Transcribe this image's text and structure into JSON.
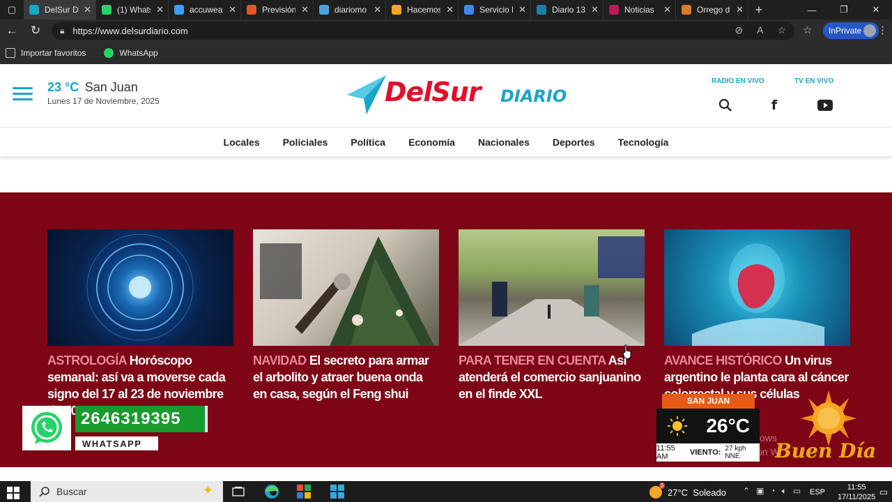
{
  "browser": {
    "tabs": [
      {
        "title": "DelSur Di",
        "color": "#1aa4c8",
        "active": true
      },
      {
        "title": "(1) Whats",
        "color": "#25d366"
      },
      {
        "title": "accuweat",
        "color": "#3aa0ff"
      },
      {
        "title": "Previsión",
        "color": "#e8542a"
      },
      {
        "title": "diariomo",
        "color": "#4aa3df"
      },
      {
        "title": "Hacemos",
        "color": "#f5a623"
      },
      {
        "title": "Servicio M",
        "color": "#4285f4"
      },
      {
        "title": "Diario 13",
        "color": "#1d7fa8"
      },
      {
        "title": "Noticias",
        "color": "#c2185b"
      },
      {
        "title": "Orrego d",
        "color": "#e07a2d"
      }
    ],
    "url": "https://www.delsurdiario.com",
    "inprivate_label": "InPrivate",
    "favorites": [
      {
        "label": "Importar favoritos",
        "icon": "import-favorites-icon"
      },
      {
        "label": "WhatsApp",
        "icon": "whatsapp-icon"
      }
    ]
  },
  "site": {
    "weather": {
      "temp": "23 °C",
      "city": "San Juan",
      "date": "Lunes 17 de Noviembre, 2025"
    },
    "logo": {
      "main": "DelSur",
      "sub": "DIARIO"
    },
    "top_links": {
      "radio": "RADIO EN VIVO",
      "tv": "TV EN VIVO"
    },
    "nav": [
      "Locales",
      "Policiales",
      "Política",
      "Economía",
      "Nacionales",
      "Deportes",
      "Tecnología"
    ],
    "articles": [
      {
        "category": "ASTROLOGÍA",
        "title": "Horóscopo semanal: así va a moverse cada signo del 17 al 23 de noviembre de 2025"
      },
      {
        "category": "NAVIDAD",
        "title": "El secreto para armar el arbolito y atraer buena onda en casa, según el Feng shui"
      },
      {
        "category": "PARA TENER EN CUENTA",
        "title": "Así atenderá el comercio sanjuanino en el finde XXL"
      },
      {
        "category": "AVANCE HISTÓRICO",
        "title": "Un virus argentino le planta cara al cáncer colorrectal y sus células"
      }
    ]
  },
  "overlays": {
    "whatsapp": {
      "number": "2646319395",
      "label": "WHATSAPP"
    },
    "weather_widget": {
      "city": "SAN JUAN",
      "temp": "26°C",
      "time": "11:55 AM",
      "wind_label": "VIENTO:",
      "wind_value": "27 kph NNE"
    },
    "watermark_text": [
      "ows",
      "on Wi"
    ],
    "buen_dia": "Buen Día"
  },
  "taskbar": {
    "search_placeholder": "Buscar",
    "weather": "27°C  Soleado",
    "weather_badge": "3",
    "lang": "ESP",
    "time": "11:55",
    "date": "17/11/2025"
  }
}
